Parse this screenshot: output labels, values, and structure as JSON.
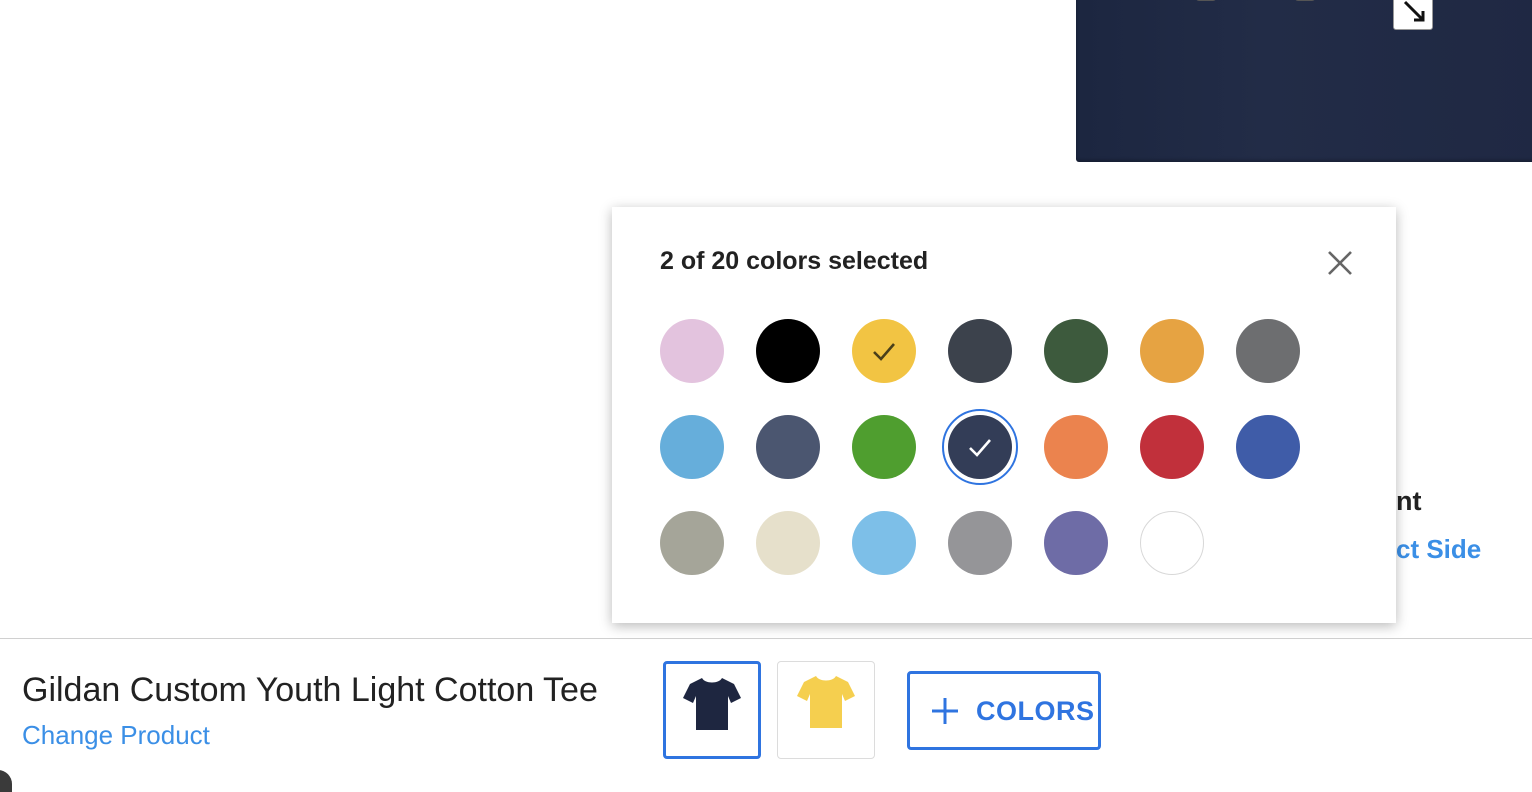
{
  "popover": {
    "title": "2 of 20 colors selected",
    "close_icon": "close-icon",
    "swatches": [
      {
        "color": "#e3c3de",
        "checked": false,
        "check_color": ""
      },
      {
        "color": "#000000",
        "checked": false,
        "check_color": ""
      },
      {
        "color": "#f2c443",
        "checked": true,
        "check_color": "#4a3f1a"
      },
      {
        "color": "#3c424c",
        "checked": false,
        "check_color": ""
      },
      {
        "color": "#3d5a3d",
        "checked": false,
        "check_color": ""
      },
      {
        "color": "#e6a342",
        "checked": false,
        "check_color": ""
      },
      {
        "color": "#6d6e70",
        "checked": false,
        "check_color": ""
      },
      {
        "color": "#66aedb",
        "checked": false,
        "check_color": ""
      },
      {
        "color": "#4b5670",
        "checked": false,
        "check_color": ""
      },
      {
        "color": "#4f9e2f",
        "checked": false,
        "check_color": ""
      },
      {
        "color": "#333d57",
        "checked": true,
        "check_color": "#ffffff"
      },
      {
        "color": "#eb834e",
        "checked": false,
        "check_color": ""
      },
      {
        "color": "#c1303b",
        "checked": false,
        "check_color": ""
      },
      {
        "color": "#3f5ca8",
        "checked": false,
        "check_color": ""
      },
      {
        "color": "#a5a599",
        "checked": false,
        "check_color": ""
      },
      {
        "color": "#e6e0cb",
        "checked": false,
        "check_color": ""
      },
      {
        "color": "#7dbfe8",
        "checked": false,
        "check_color": ""
      },
      {
        "color": "#959598",
        "checked": false,
        "check_color": ""
      },
      {
        "color": "#6e6ca6",
        "checked": false,
        "check_color": ""
      },
      {
        "color": "#ffffff",
        "checked": false,
        "check_color": ""
      }
    ]
  },
  "side_panel": {
    "label_visible": "nt",
    "link_visible": "ct Side"
  },
  "product": {
    "name": "Gildan Custom Youth Light Cotton Tee",
    "change_link": "Change Product",
    "thumbnails": [
      {
        "color": "#1e2640",
        "selected": true,
        "icon": "tshirt-icon"
      },
      {
        "color": "#f5cf4f",
        "selected": false,
        "icon": "tshirt-icon"
      }
    ],
    "colors_button": {
      "label": "COLORS",
      "icon": "plus-icon"
    }
  },
  "colors": {
    "accent": "#2f74e0",
    "link": "#3b8fe6",
    "shirt_preview": "#1f2843"
  }
}
